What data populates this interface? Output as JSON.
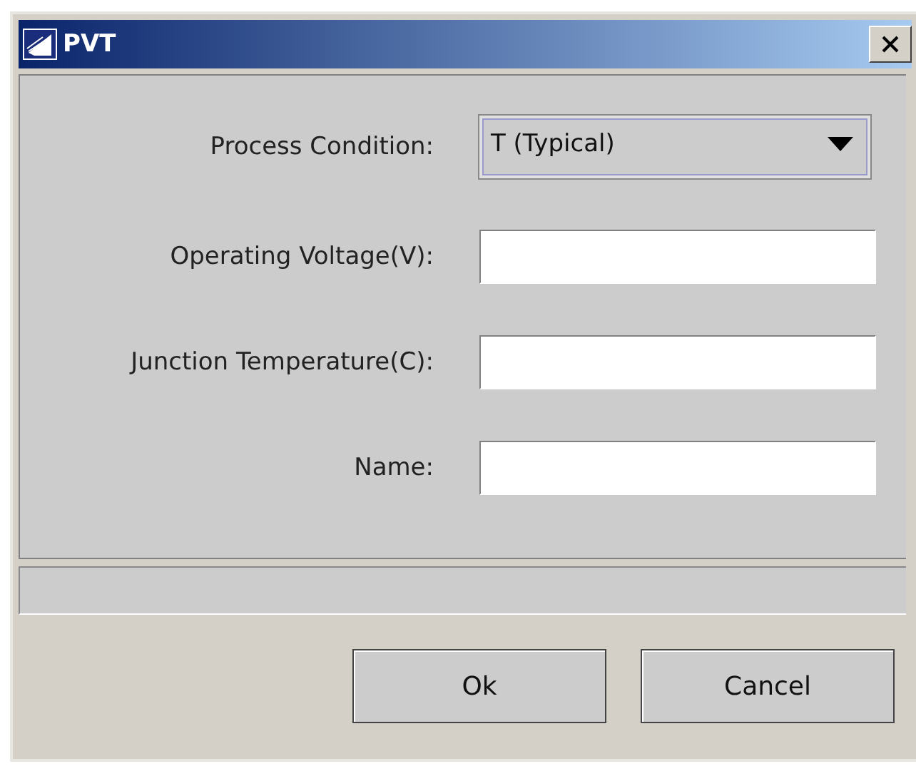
{
  "window": {
    "title": "PVT"
  },
  "fields": [
    {
      "label": "Process Condition:",
      "kind": "dropdown",
      "value": "T (Typical)"
    },
    {
      "label": "Operating Voltage(V):",
      "kind": "text"
    },
    {
      "label": "Junction Temperature(C):",
      "kind": "text"
    },
    {
      "label": "Name:",
      "kind": "text"
    }
  ],
  "buttons": [
    "Ok",
    "Cancel"
  ]
}
